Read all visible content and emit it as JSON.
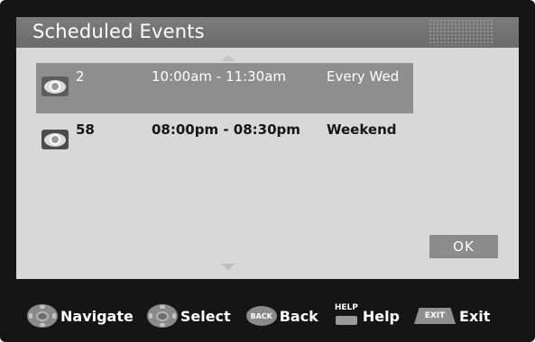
{
  "dialog": {
    "title": "Scheduled Events",
    "ok_label": "OK"
  },
  "events": [
    {
      "channel": "2",
      "time": "10:00am -  11:30am",
      "repeat": "Every Wed",
      "icon": "eye-icon",
      "selected": true
    },
    {
      "channel": "58",
      "time": "08:00pm - 08:30pm",
      "repeat": "Weekend",
      "icon": "eye-icon",
      "selected": false
    }
  ],
  "legend": {
    "navigate": "Navigate",
    "select": "Select",
    "back": "Back",
    "back_key": "BACK",
    "help": "Help",
    "help_key": "HELP",
    "exit": "Exit",
    "exit_key": "EXIT"
  },
  "colors": {
    "frame": "#151515",
    "dialog_bg": "#d8d8d8",
    "header_bg": "#737373",
    "selected_row": "#8e8e8e",
    "ok_button": "#8c8c8c"
  }
}
